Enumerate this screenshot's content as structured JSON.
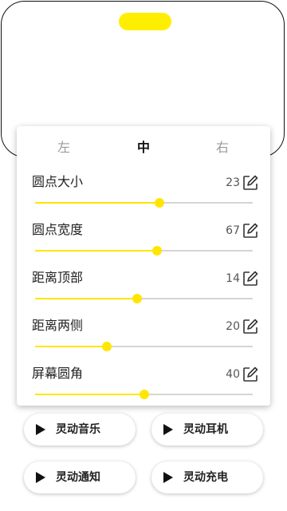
{
  "tabs": [
    {
      "label": "左",
      "active": false
    },
    {
      "label": "中",
      "active": true
    },
    {
      "label": "右",
      "active": false
    }
  ],
  "settings": [
    {
      "label": "圆点大小",
      "value": "23",
      "fill_fraction": 0.57
    },
    {
      "label": "圆点宽度",
      "value": "67",
      "fill_fraction": 0.56
    },
    {
      "label": "距离顶部",
      "value": "14",
      "fill_fraction": 0.47
    },
    {
      "label": "距离两侧",
      "value": "20",
      "fill_fraction": 0.33
    },
    {
      "label": "屏幕圆角",
      "value": "40",
      "fill_fraction": 0.5
    }
  ],
  "buttons": [
    {
      "label": "灵动音乐"
    },
    {
      "label": "灵动耳机"
    },
    {
      "label": "灵动通知"
    },
    {
      "label": "灵动充电"
    }
  ],
  "colors": {
    "accent": "#ffee00",
    "track": "#d5d5d5"
  },
  "icons": {
    "edit": "edit-icon",
    "play": "play-icon"
  }
}
